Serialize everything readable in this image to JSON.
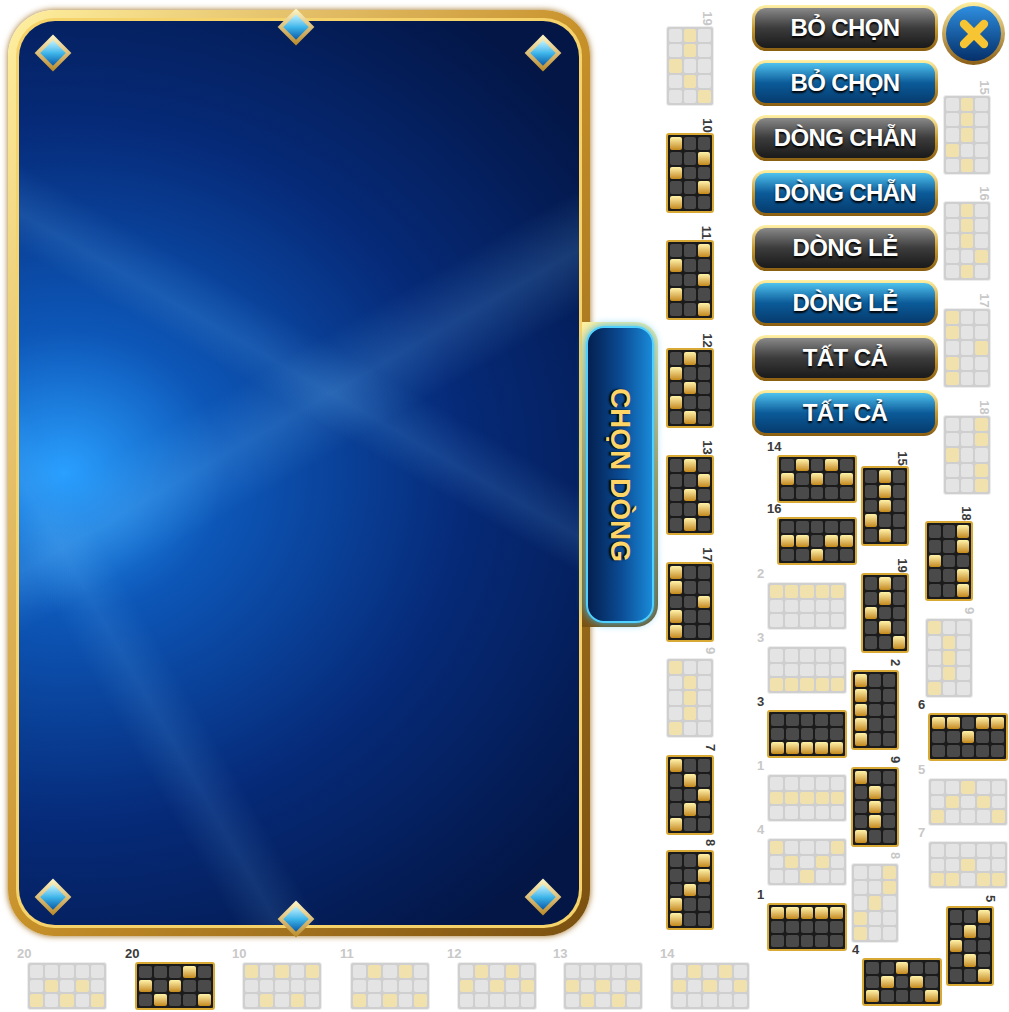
{
  "side_tab": {
    "label": "CHỌN DÒNG"
  },
  "buttons": [
    {
      "label": "BỎ CHỌN",
      "kind": "dark"
    },
    {
      "label": "BỎ CHỌN",
      "kind": "blue"
    },
    {
      "label": "DÒNG CHẴN",
      "kind": "dark"
    },
    {
      "label": "DÒNG CHẴN",
      "kind": "blue"
    },
    {
      "label": "DÒNG LẺ",
      "kind": "dark"
    },
    {
      "label": "DÒNG LẺ",
      "kind": "blue"
    },
    {
      "label": "TẤT CẢ",
      "kind": "dark"
    },
    {
      "label": "TẤT CẢ",
      "kind": "blue"
    }
  ],
  "thumbnails": [
    {
      "number": "19",
      "active": false,
      "kind": "vertical",
      "path": [
        1,
        1,
        0,
        1,
        2
      ]
    },
    {
      "number": "10",
      "active": true,
      "kind": "vertical",
      "path": [
        0,
        2,
        0,
        2,
        0
      ]
    },
    {
      "number": "11",
      "active": true,
      "kind": "vertical",
      "path": [
        2,
        0,
        2,
        0,
        2
      ]
    },
    {
      "number": "12",
      "active": true,
      "kind": "vertical",
      "path": [
        1,
        0,
        1,
        0,
        1
      ]
    },
    {
      "number": "13",
      "active": true,
      "kind": "vertical",
      "path": [
        1,
        2,
        1,
        2,
        1
      ]
    },
    {
      "number": "17",
      "active": true,
      "kind": "vertical",
      "path": [
        0,
        0,
        2,
        0,
        0
      ]
    },
    {
      "number": "9",
      "active": false,
      "kind": "vertical",
      "path": [
        0,
        1,
        1,
        1,
        0
      ]
    },
    {
      "number": "7",
      "active": true,
      "kind": "vertical",
      "path": [
        0,
        1,
        2,
        1,
        0
      ]
    },
    {
      "number": "8",
      "active": true,
      "kind": "vertical",
      "path": [
        2,
        2,
        1,
        0,
        0
      ]
    },
    {
      "number": "15",
      "active": false,
      "kind": "vertical",
      "path": [
        1,
        1,
        1,
        0,
        1
      ]
    },
    {
      "number": "16",
      "active": false,
      "kind": "vertical",
      "path": [
        1,
        1,
        1,
        2,
        1
      ]
    },
    {
      "number": "17",
      "active": false,
      "kind": "vertical",
      "path": [
        0,
        0,
        2,
        0,
        0
      ]
    },
    {
      "number": "18",
      "active": false,
      "kind": "vertical",
      "path": [
        2,
        2,
        0,
        2,
        2
      ]
    },
    {
      "number": "15",
      "active": true,
      "kind": "vertical",
      "path": [
        1,
        1,
        1,
        0,
        1
      ]
    },
    {
      "number": "18",
      "active": true,
      "kind": "vertical",
      "path": [
        2,
        2,
        0,
        2,
        2
      ]
    },
    {
      "number": "19",
      "active": true,
      "kind": "vertical",
      "path": [
        1,
        1,
        0,
        1,
        2
      ]
    },
    {
      "number": "9",
      "active": false,
      "kind": "vertical",
      "path": [
        0,
        1,
        1,
        1,
        0
      ]
    },
    {
      "number": "2",
      "active": true,
      "kind": "vertical",
      "path": [
        0,
        0,
        0,
        0,
        0
      ]
    },
    {
      "number": "9",
      "active": true,
      "kind": "vertical",
      "path": [
        0,
        1,
        1,
        1,
        0
      ]
    },
    {
      "number": "8",
      "active": false,
      "kind": "vertical",
      "path": [
        2,
        2,
        1,
        0,
        0
      ]
    },
    {
      "number": "5",
      "active": true,
      "kind": "vertical",
      "path": [
        2,
        1,
        0,
        1,
        2
      ]
    },
    {
      "number": "14",
      "active": true,
      "kind": "horizontal",
      "path": [
        1,
        0,
        1,
        0,
        1
      ]
    },
    {
      "number": "16",
      "active": true,
      "kind": "horizontal",
      "path": [
        1,
        1,
        2,
        1,
        1
      ]
    },
    {
      "number": "2",
      "active": false,
      "kind": "horizontal",
      "path": [
        0,
        0,
        0,
        0,
        0
      ]
    },
    {
      "number": "3",
      "active": false,
      "kind": "horizontal",
      "path": [
        2,
        2,
        2,
        2,
        2
      ]
    },
    {
      "number": "3",
      "active": true,
      "kind": "horizontal",
      "path": [
        2,
        2,
        2,
        2,
        2
      ]
    },
    {
      "number": "6",
      "active": true,
      "kind": "horizontal",
      "path": [
        0,
        0,
        1,
        0,
        0
      ]
    },
    {
      "number": "1",
      "active": false,
      "kind": "horizontal",
      "path": [
        1,
        1,
        1,
        1,
        1
      ]
    },
    {
      "number": "5",
      "active": false,
      "kind": "horizontal",
      "path": [
        2,
        1,
        0,
        1,
        2
      ]
    },
    {
      "number": "4",
      "active": false,
      "kind": "horizontal",
      "path": [
        0,
        1,
        2,
        1,
        0
      ]
    },
    {
      "number": "7",
      "active": false,
      "kind": "horizontal",
      "path": [
        2,
        2,
        1,
        2,
        2
      ]
    },
    {
      "number": "1",
      "active": true,
      "kind": "horizontal",
      "path": [
        0,
        0,
        0,
        0,
        0
      ]
    },
    {
      "number": "4",
      "active": true,
      "kind": "horizontal",
      "path": [
        2,
        1,
        0,
        1,
        2
      ]
    },
    {
      "number": "20",
      "active": false,
      "kind": "horizontal",
      "path": [
        2,
        1,
        2,
        1,
        2
      ]
    },
    {
      "number": "20",
      "active": true,
      "kind": "horizontal",
      "path": [
        1,
        2,
        1,
        0,
        2
      ]
    },
    {
      "number": "10",
      "active": false,
      "kind": "horizontal",
      "path": [
        0,
        2,
        0,
        2,
        0
      ]
    },
    {
      "number": "11",
      "active": false,
      "kind": "horizontal",
      "path": [
        2,
        0,
        2,
        0,
        2
      ]
    },
    {
      "number": "12",
      "active": false,
      "kind": "horizontal",
      "path": [
        1,
        0,
        1,
        0,
        1
      ]
    },
    {
      "number": "13",
      "active": false,
      "kind": "horizontal",
      "path": [
        1,
        2,
        1,
        2,
        1
      ]
    },
    {
      "number": "14",
      "active": false,
      "kind": "horizontal",
      "path": [
        1,
        0,
        1,
        0,
        1
      ]
    }
  ]
}
